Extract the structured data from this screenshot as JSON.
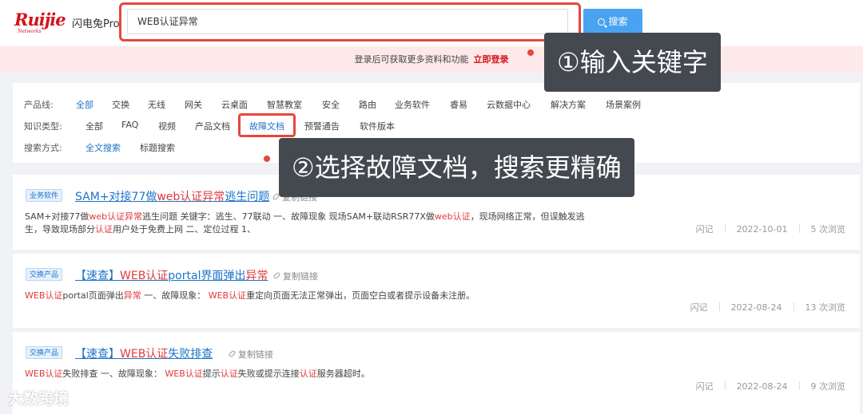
{
  "header": {
    "brand_logo": "Ruijie",
    "brand_sub": "Networks",
    "product": "闪电兔Pro",
    "search_value": "WEB认证异常",
    "search_button": "搜索"
  },
  "banner": {
    "text": "登录后可获取更多资料和功能",
    "login_link": "立即登录"
  },
  "filters": {
    "product_label": "产品线:",
    "product_options": [
      "全部",
      "交换",
      "无线",
      "网关",
      "云桌面",
      "智慧教室",
      "安全",
      "路由",
      "业务软件",
      "睿易",
      "云数据中心",
      "解决方案",
      "场景案例"
    ],
    "type_label": "知识类型:",
    "type_options": [
      "全部",
      "FAQ",
      "视频",
      "产品文档",
      "故障文档",
      "预警通告",
      "软件版本"
    ],
    "mode_label": "搜索方式:",
    "mode_options": [
      "全文搜索",
      "标题搜索"
    ]
  },
  "callouts": {
    "step1": "①输入关键字",
    "step2": "②选择故障文档，搜索更精确"
  },
  "results": [
    {
      "tag": "业务软件",
      "title": [
        "SAM+对接77做",
        "web认证异常",
        "逃生问题"
      ],
      "copy": "复制链接",
      "snippet1": [
        "SAM+对接77做",
        "web认证异常",
        "逃生问题 关键字：逃生、77联动 一、故障现象 现场SAM+联动RSR77X做",
        "web认证",
        "，现场网络正常，但误触发逃"
      ],
      "snippet2": [
        "生，导致现场部分",
        "认证",
        "用户处于免费上网 二、定位过程 1、"
      ],
      "author": "闪记",
      "date": "2022-10-01",
      "views": "5 次浏览"
    },
    {
      "tag": "交换产品",
      "title": [
        "【速查】",
        "WEB认证",
        "portal界面弹出",
        "异常"
      ],
      "copy": "复制链接",
      "snippet1": [
        "WEB认证",
        "portal页面弹出",
        "异常",
        " 一、故障现象： ",
        "WEB认证",
        "重定向页面无法正常弹出，页面空白或者提示设备未注册。"
      ],
      "author": "闪记",
      "date": "2022-08-24",
      "views": "13 次浏览"
    },
    {
      "tag": "交换产品",
      "title": [
        "【速查】",
        "WEB认证",
        "失败排查"
      ],
      "copy": "复制链接",
      "snippet1": [
        "WEB认证",
        "失败排查 一、故障现象： ",
        "WEB认证",
        "提示",
        "认证",
        "失败或提示连接",
        "认证",
        "服务器超时。"
      ],
      "author": "闪记",
      "date": "2022-08-24",
      "views": "9 次浏览"
    }
  ],
  "watermark": "大数跨境",
  "colors": {
    "brand_red": "#d6141c",
    "link_blue": "#1e73c8",
    "highlight_red": "#e03a3a",
    "button_blue": "#4aa3f0",
    "callout_bg": "#444950"
  }
}
